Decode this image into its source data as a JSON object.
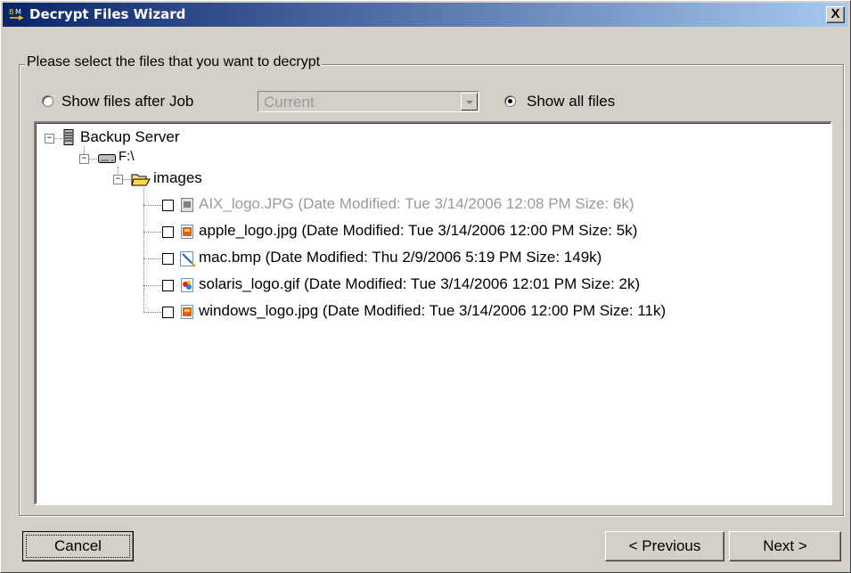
{
  "window": {
    "title": "Decrypt Files Wizard",
    "close_label": "X"
  },
  "group": {
    "legend": "Please select the files that you want to decrypt"
  },
  "options": {
    "show_after_job_label": "Show files after Job",
    "job_combo_value": "Current",
    "show_all_label": "Show all files",
    "selected": "show_all"
  },
  "tree": {
    "server": "Backup Server",
    "drive": "F:\\",
    "folder": "images",
    "files": [
      {
        "label": "AIX_logo.JPG (Date Modified: Tue 3/14/2006 12:08 PM Size: 6k)",
        "icon": "image-file-icon-gray",
        "disabled": true,
        "checked": false
      },
      {
        "label": "apple_logo.jpg (Date Modified: Tue 3/14/2006 12:00 PM Size: 5k)",
        "icon": "jpg-file-icon",
        "disabled": false,
        "checked": false
      },
      {
        "label": "mac.bmp (Date Modified: Thu 2/9/2006 5:19 PM Size: 149k)",
        "icon": "bmp-file-icon",
        "disabled": false,
        "checked": false
      },
      {
        "label": "solaris_logo.gif (Date Modified: Tue 3/14/2006 12:01 PM Size: 2k)",
        "icon": "gif-file-icon",
        "disabled": false,
        "checked": false
      },
      {
        "label": "windows_logo.jpg (Date Modified: Tue 3/14/2006 12:00 PM Size: 11k)",
        "icon": "jpg-file-icon",
        "disabled": false,
        "checked": false
      }
    ]
  },
  "buttons": {
    "cancel": "Cancel",
    "previous": "< Previous",
    "next": "Next >"
  }
}
